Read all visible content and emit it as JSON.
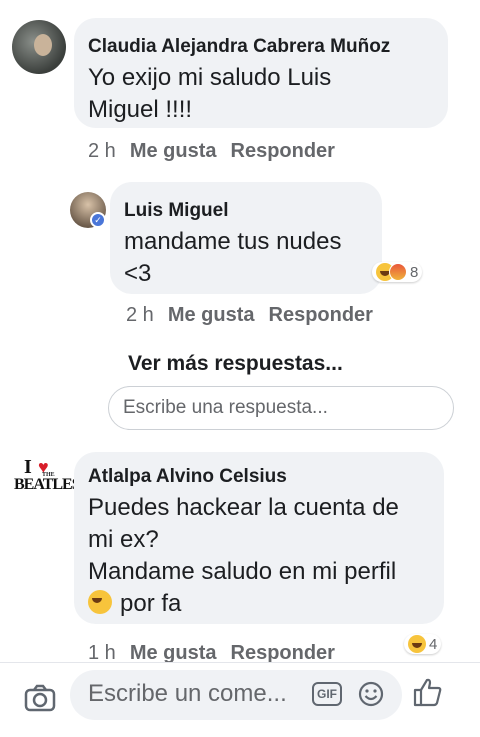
{
  "comments": [
    {
      "author": "Claudia Alejandra Cabrera Muñoz",
      "text_lines": [
        "Yo exijo mi saludo Luis",
        "Miguel !!!!"
      ],
      "time": "2 h",
      "like_label": "Me gusta",
      "reply_label": "Responder"
    },
    {
      "author": "Atlalpa Alvino Celsius",
      "text_lines": [
        "Puedes hackear la cuenta de",
        "mi ex?",
        "Mandame saludo en mi perfil"
      ],
      "text_tail": "por fa",
      "avatar_text": {
        "i": "I",
        "the": "THE",
        "name": "BEATLES"
      },
      "time": "1 h",
      "like_label": "Me gusta",
      "reply_label": "Responder",
      "reaction_count": "4"
    }
  ],
  "reply": {
    "author": "Luis Miguel",
    "text_lines": [
      "mandame tus nudes",
      "<3"
    ],
    "time": "2 h",
    "like_label": "Me gusta",
    "reply_label": "Responder",
    "reaction_count": "8"
  },
  "view_more": "Ver más respuestas...",
  "reply_placeholder": "Escribe una respuesta...",
  "composer": {
    "placeholder": "Escribe un come...",
    "gif_label": "GIF"
  },
  "icons": [
    "camera-icon",
    "gif-icon",
    "smiley-icon",
    "thumbs-up-icon",
    "haha-reaction-icon",
    "angry-reaction-icon",
    "grin-emoji-icon",
    "verified-icon"
  ],
  "colors": {
    "bubble": "#f0f2f5",
    "meta": "#65676b",
    "verified": "#4a76d8",
    "text": "#1c1e21"
  }
}
